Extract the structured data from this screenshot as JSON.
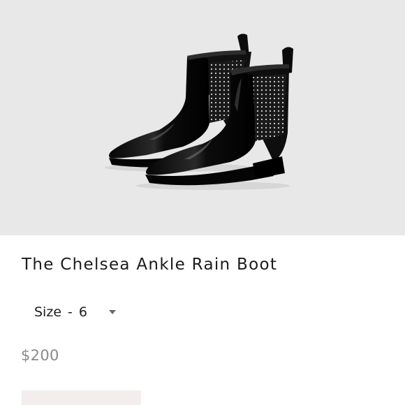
{
  "product": {
    "title": "The Chelsea Ankle Rain Boot",
    "image_alt": "black patent chelsea rain boots with studded elastic panels"
  },
  "size_selector": {
    "label": "Size",
    "separator": "-",
    "value": "6",
    "icon": "caret-down-icon"
  },
  "price": {
    "amount": "$200"
  },
  "colors": {
    "hero_background": "#e8e8e8",
    "title_text": "#1b1b1b",
    "price_text": "#8a8a8a",
    "button_background": "#f4edee"
  }
}
